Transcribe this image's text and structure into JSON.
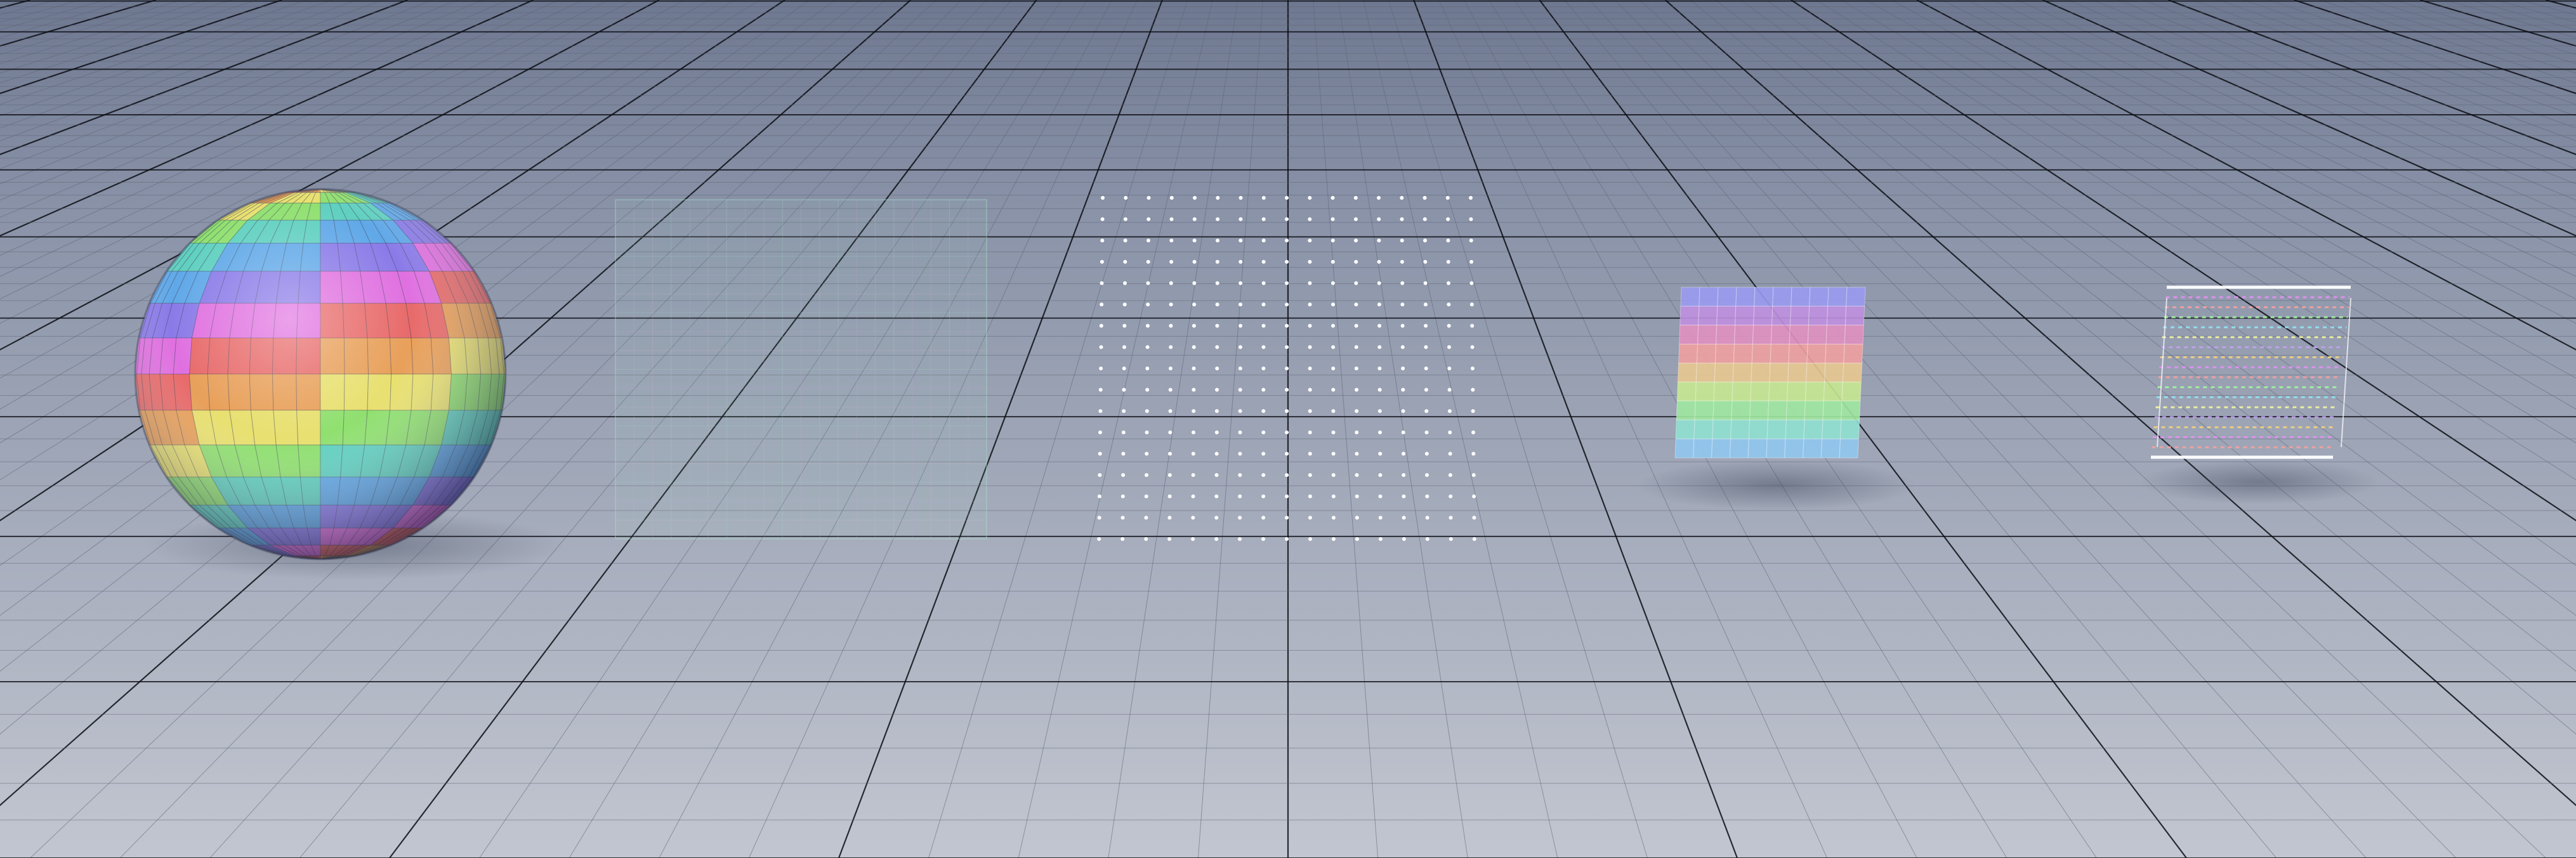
{
  "scene": {
    "description_free": true,
    "background": {
      "sky_top": "#6f7a90",
      "floor_far": "#8d96aa",
      "floor_near": "#bcc1cb"
    },
    "grid": {
      "minor_line": "#5d6476",
      "major_line": "#0c0e14",
      "major_every": 5
    },
    "objects": [
      {
        "name": "sphere",
        "style": "shaded-color-checker",
        "colors": [
          "#e86a6a",
          "#e8a05a",
          "#e8e070",
          "#90e070",
          "#60d0c0",
          "#60a8e8",
          "#8a7ae8",
          "#e070e0"
        ]
      },
      {
        "name": "ghost-box",
        "style": "transparent-wireframe",
        "colors": [
          "#a8e0c8",
          "#c8a8e0",
          "#d8b8c8"
        ]
      },
      {
        "name": "point-cloud",
        "style": "points",
        "colors": [
          "#ffffff"
        ],
        "cols": 17,
        "rows": 17
      },
      {
        "name": "color-panel",
        "style": "flat-color-checker",
        "colors": [
          "#9a9af0",
          "#c090e0",
          "#e090c0",
          "#f0a0a0",
          "#e8c890",
          "#c8e890",
          "#a0e8a0",
          "#90e0d0",
          "#90c8f0"
        ]
      },
      {
        "name": "line-stack",
        "style": "colored-lines",
        "colors": [
          "#ffffff",
          "#f0d080",
          "#e090f0",
          "#f0a0a0",
          "#a0f0a0",
          "#90e0f0",
          "#f0f0a0",
          "#c0a0f0"
        ]
      }
    ]
  }
}
